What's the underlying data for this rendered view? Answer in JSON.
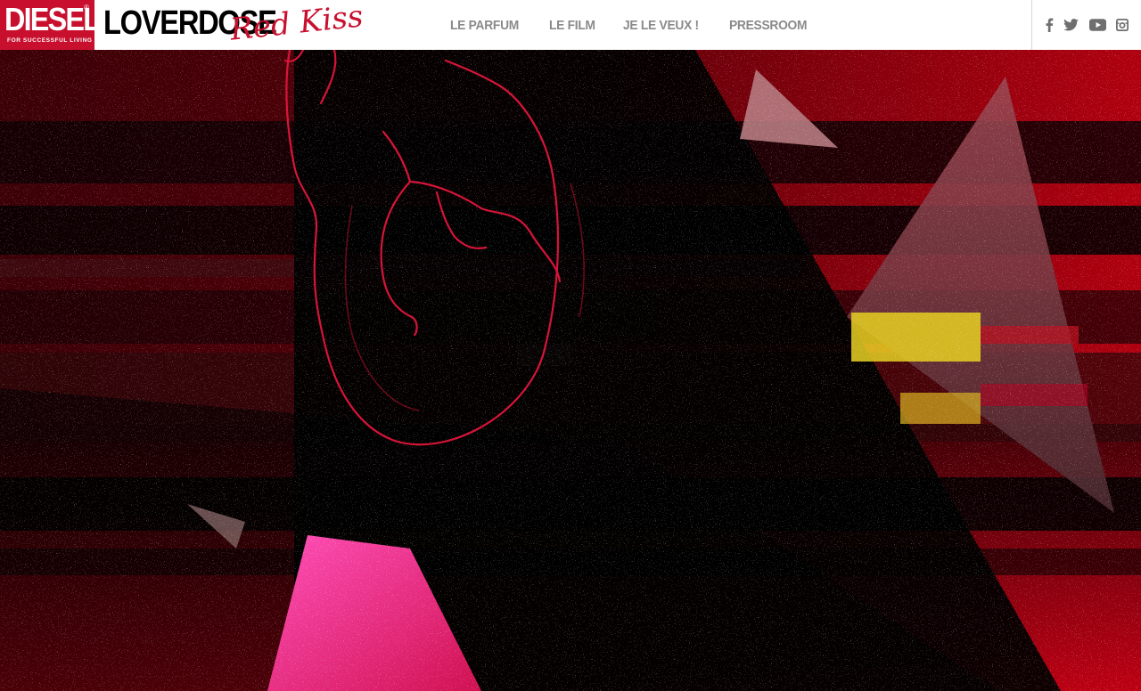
{
  "brand": {
    "diesel": "DIESEL",
    "diesel_tagline": "FOR SUCCESSFUL LIVING",
    "diesel_reg": "®",
    "product": "LOVERDOSE",
    "product_script": "Red Kiss"
  },
  "nav": {
    "items": [
      {
        "label": "LE PARFUM"
      },
      {
        "label": "LE FILM"
      },
      {
        "label": "JE LE VEUX !"
      },
      {
        "label": "PRESSROOM"
      }
    ]
  },
  "social": {
    "icons": [
      "facebook-icon",
      "twitter-icon",
      "youtube-icon",
      "instagram-icon"
    ]
  },
  "colors": {
    "brand_red": "#c8102e",
    "nav_gray": "#8a8a8a",
    "hero_red": "#b3001b",
    "heart_line": "#e0163c",
    "pink": "#e8349a"
  }
}
